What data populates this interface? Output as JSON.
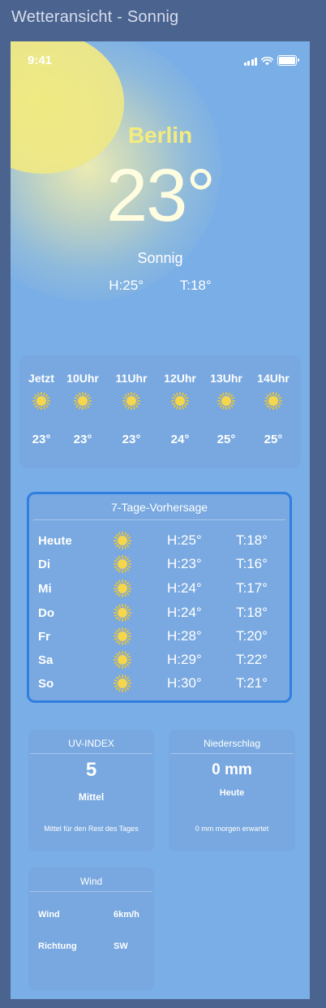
{
  "window": {
    "title": "Wetteransicht - Sonnig"
  },
  "status": {
    "time": "9:41"
  },
  "current": {
    "city": "Berlin",
    "temp": "23°",
    "condition": "Sonnig",
    "high": "H:25°",
    "low": "T:18°"
  },
  "hourly": [
    {
      "label": "Jetzt",
      "temp": "23°",
      "icon": "sun-icon"
    },
    {
      "label": "10Uhr",
      "temp": "23°",
      "icon": "sun-icon"
    },
    {
      "label": "11Uhr",
      "temp": "23°",
      "icon": "sun-icon"
    },
    {
      "label": "12Uhr",
      "temp": "24°",
      "icon": "sun-icon"
    },
    {
      "label": "13Uhr",
      "temp": "25°",
      "icon": "sun-icon"
    },
    {
      "label": "14Uhr",
      "temp": "25°",
      "icon": "sun-icon"
    }
  ],
  "forecast": {
    "title": "7-Tage-Vorhersage",
    "days": [
      {
        "day": "Heute",
        "high": "H:25°",
        "low": "T:18°",
        "icon": "sun-icon"
      },
      {
        "day": "Di",
        "high": "H:23°",
        "low": "T:16°",
        "icon": "sun-icon"
      },
      {
        "day": "Mi",
        "high": "H:24°",
        "low": "T:17°",
        "icon": "sun-icon"
      },
      {
        "day": "Do",
        "high": "H:24°",
        "low": "T:18°",
        "icon": "sun-icon"
      },
      {
        "day": "Fr",
        "high": "H:28°",
        "low": "T:20°",
        "icon": "sun-icon"
      },
      {
        "day": "Sa",
        "high": "H:29°",
        "low": "T:22°",
        "icon": "sun-icon"
      },
      {
        "day": "So",
        "high": "H:30°",
        "low": "T:21°",
        "icon": "sun-icon"
      }
    ]
  },
  "uv": {
    "title": "UV-INDEX",
    "value": "5",
    "level": "Mittel",
    "note": "Mittel für den Rest des Tages"
  },
  "precip": {
    "title": "Niederschlag",
    "value": "0 mm",
    "period": "Heute",
    "note": "0 mm morgen erwartet"
  },
  "wind": {
    "title": "Wind",
    "rows": [
      {
        "key": "Wind",
        "value": "6km/h"
      },
      {
        "key": "Richtung",
        "value": "SW"
      }
    ]
  },
  "colors": {
    "sun": "#f2c531",
    "accent": "#2f7fe0",
    "city": "#f4ec7e",
    "background": "#7aaee6"
  }
}
